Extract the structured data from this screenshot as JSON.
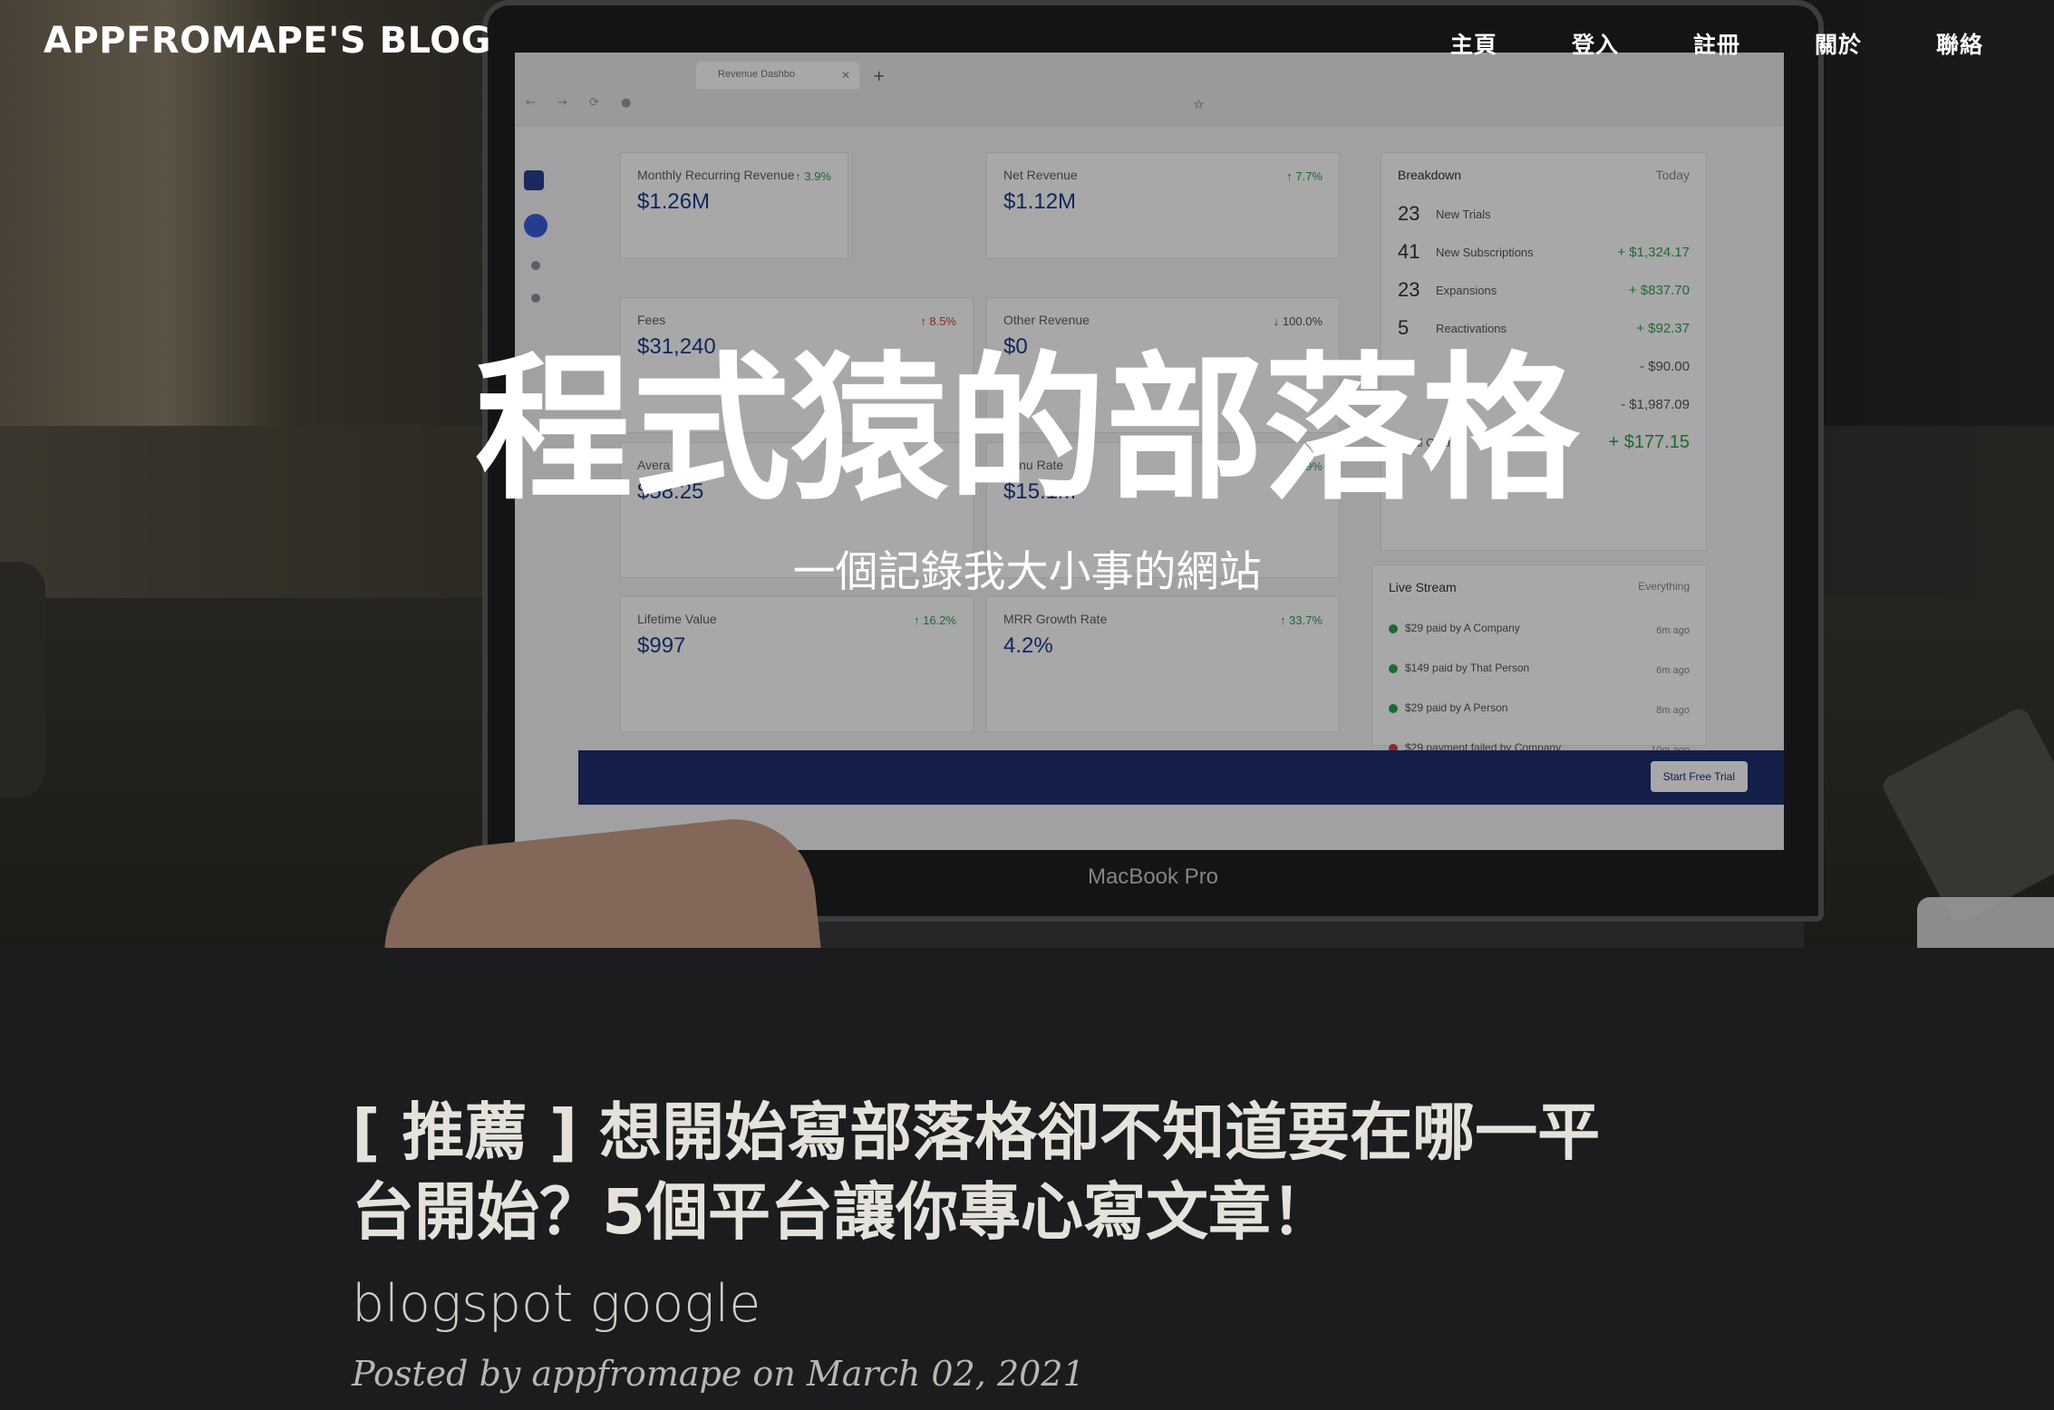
{
  "nav": {
    "brand": "APPFROMAPE'S BLOG",
    "items": [
      "主頁",
      "登入",
      "註冊",
      "關於",
      "聯絡"
    ]
  },
  "hero": {
    "title": "程式猿的部落格",
    "subtitle": "一個記錄我大小事的網站",
    "laptop": {
      "brand": "MacBook Pro",
      "browser_tab": "Revenue Dashbo",
      "cards": [
        {
          "label": "Monthly Recurring Revenue",
          "value": "$1.26M",
          "change": "3.9%"
        },
        {
          "label": "Net Revenue",
          "value": "$1.12M",
          "change": "7.7%"
        },
        {
          "label": "Fees",
          "value": "$31,240",
          "change": "8.5%"
        },
        {
          "label": "Other Revenue",
          "value": "$0",
          "change": "100.0%"
        },
        {
          "label": "Avera",
          "value": "$58.25",
          "change": ""
        },
        {
          "label": "Annu  Rate",
          "value": "$15.1M",
          "change": "3.9%"
        },
        {
          "label": "Lifetime Value",
          "value": "$997",
          "change": "16.2%"
        },
        {
          "label": "MRR Growth Rate",
          "value": "4.2%",
          "change": "33.7%"
        }
      ],
      "breakdown": {
        "title": "Breakdown",
        "filter": "Today",
        "rows": [
          {
            "count": "23",
            "label": "New Trials",
            "amount": ""
          },
          {
            "count": "41",
            "label": "New Subscriptions",
            "amount": "+ $1,324.17"
          },
          {
            "count": "23",
            "label": "Expansions",
            "amount": "+ $837.70"
          },
          {
            "count": "5",
            "label": "Reactivations",
            "amount": "+ $92.37"
          },
          {
            "count": "",
            "label": "",
            "amount": "- $90.00"
          },
          {
            "count": "",
            "label": "",
            "amount": "- $1,987.09"
          }
        ],
        "total_label": "Total Change",
        "total_value": "+ $177.15"
      },
      "live_stream": {
        "title": "Live Stream",
        "filter": "Everything",
        "rows": [
          {
            "text": "$29 paid by A Company",
            "ago": "6m ago",
            "status": "ok"
          },
          {
            "text": "$149 paid by That Person",
            "ago": "6m ago",
            "status": "ok"
          },
          {
            "text": "$29 paid by A Person",
            "ago": "8m ago",
            "status": "ok"
          },
          {
            "text": "$29 payment failed by Company",
            "ago": "10m ago",
            "status": "fail"
          }
        ]
      },
      "cta": "Start Free Trial"
    }
  },
  "post": {
    "title": "[ 推薦 ] 想開始寫部落格卻不知道要在哪一平台開始？5個平台讓你專心寫文章！",
    "subtitle": "blogspot google",
    "meta": "Posted by appfromape on March 02, 2021"
  }
}
